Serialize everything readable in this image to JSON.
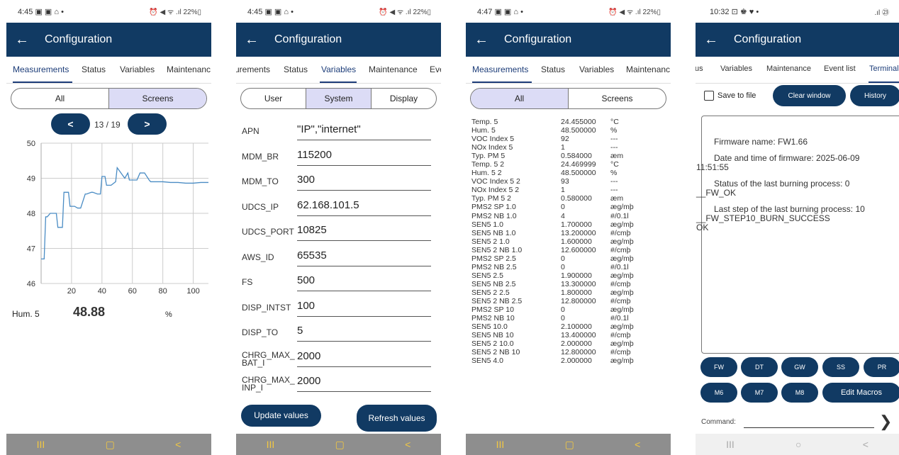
{
  "colors": {
    "appbar": "#113a63",
    "accent": "#1d3d79",
    "segment_selected": "#dcdcf6",
    "navbar": "#8e8e8e",
    "nav_icons": "#f2c842"
  },
  "screens": [
    {
      "status_time": "4:45",
      "status_icons": "▣ ▣ ⌂ •",
      "status_right": "⏰ ◀ ᯤ .ıl 22%▯",
      "title": "Configuration",
      "back_icon": "←",
      "tabs": [
        "Measurements",
        "Status",
        "Variables",
        "Maintenanc"
      ],
      "segments": [
        "All",
        "Screens"
      ],
      "pager": {
        "prev": "<",
        "label": "13 / 19",
        "next": ">"
      },
      "chart_data": {
        "type": "line",
        "ylim": [
          46,
          50
        ],
        "xlim": [
          0,
          110
        ],
        "yticks": [
          "50",
          "49",
          "48",
          "47",
          "46"
        ],
        "xticks": [
          "20",
          "40",
          "60",
          "80",
          "100"
        ],
        "x": [
          0,
          2,
          3,
          4,
          6,
          10,
          11,
          14,
          15,
          18,
          19,
          22,
          24,
          26,
          29,
          30,
          33,
          34,
          37,
          39,
          40,
          42,
          43,
          46,
          49,
          50,
          55,
          57,
          58,
          61,
          63,
          65,
          68,
          71,
          72,
          75,
          80,
          85,
          90,
          95,
          100,
          105,
          110
        ],
        "values": [
          46.7,
          46.7,
          47.9,
          47.9,
          48.0,
          48.0,
          47.6,
          47.6,
          48.6,
          48.6,
          48.2,
          48.2,
          48.15,
          48.15,
          48.55,
          48.55,
          48.6,
          48.6,
          48.55,
          48.55,
          49.05,
          49.05,
          48.8,
          48.8,
          48.9,
          49.3,
          49.0,
          49.15,
          48.95,
          48.95,
          48.95,
          49.15,
          49.15,
          48.95,
          48.9,
          48.9,
          48.9,
          48.88,
          48.88,
          48.86,
          48.86,
          48.88,
          48.88
        ]
      },
      "reading": {
        "label": "Hum. 5",
        "value": "48.88",
        "unit": "%"
      },
      "nav": [
        "III",
        "▢",
        "<"
      ]
    },
    {
      "status_time": "4:45",
      "status_icons": "▣ ▣ ⌂ •",
      "status_right": "⏰ ◀ ᯤ .ıl 22%▯",
      "title": "Configuration",
      "back_icon": "←",
      "tabs": [
        "urements",
        "Status",
        "Variables",
        "Maintenance",
        "Eve"
      ],
      "segments": [
        "User",
        "System",
        "Display"
      ],
      "fields": [
        {
          "label": "APN",
          "value": "\"IP\",\"internet\""
        },
        {
          "label": "MDM_BR",
          "value": "115200"
        },
        {
          "label": "MDM_TO",
          "value": "300"
        },
        {
          "label": "UDCS_IP",
          "value": "62.168.101.5"
        },
        {
          "label": "UDCS_PORT",
          "value": "10825"
        },
        {
          "label": "AWS_ID",
          "value": "65535"
        },
        {
          "label": "FS",
          "value": "500"
        },
        {
          "label": "DISP_INTST",
          "value": "100"
        },
        {
          "label": "DISP_TO",
          "value": "5"
        },
        {
          "label": "CHRG_MAX_ BAT_I",
          "value": "2000"
        },
        {
          "label": "CHRG_MAX_ INP_I",
          "value": "2000"
        }
      ],
      "buttons": {
        "update": "Update values",
        "refresh": "Refresh values"
      },
      "nav": [
        "III",
        "▢",
        "<"
      ]
    },
    {
      "status_time": "4:47",
      "status_icons": "▣ ▣ ⌂ •",
      "status_right": "⏰ ◀ ᯤ .ıl 22%▯",
      "title": "Configuration",
      "back_icon": "←",
      "tabs": [
        "Measurements",
        "Status",
        "Variables",
        "Maintenanc"
      ],
      "segments": [
        "All",
        "Screens"
      ],
      "rows": [
        [
          "Temp. 5",
          "24.455000",
          "°C"
        ],
        [
          "Hum. 5",
          "48.500000",
          "%"
        ],
        [
          "VOC Index 5",
          "92",
          "---"
        ],
        [
          "NOx Index 5",
          "1",
          "---"
        ],
        [
          "Typ. PM 5",
          "0.584000",
          "æm"
        ],
        [
          "Temp. 5 2",
          "24.469999",
          "°C"
        ],
        [
          "Hum. 5 2",
          "48.500000",
          "%"
        ],
        [
          "VOC Index 5 2",
          "93",
          "---"
        ],
        [
          "NOx Index 5 2",
          "1",
          "---"
        ],
        [
          "Typ. PM 5 2",
          "0.580000",
          "æm"
        ],
        [
          "PMS2 SP 1.0",
          "0",
          "æg/mþ"
        ],
        [
          "PMS2 NB 1.0",
          "4",
          "#/0.1l"
        ],
        [
          "SEN5 1.0",
          "1.700000",
          "æg/mþ"
        ],
        [
          "SEN5 NB 1.0",
          "13.200000",
          "#/cmþ"
        ],
        [
          "SEN5 2 1.0",
          "1.600000",
          "æg/mþ"
        ],
        [
          "SEN5 2 NB 1.0",
          "12.600000",
          "#/cmþ"
        ],
        [
          "PMS2 SP 2.5",
          "0",
          "æg/mþ"
        ],
        [
          "PMS2 NB 2.5",
          "0",
          "#/0.1l"
        ],
        [
          "SEN5 2.5",
          "1.900000",
          "æg/mþ"
        ],
        [
          "SEN5 NB 2.5",
          "13.300000",
          "#/cmþ"
        ],
        [
          "SEN5 2 2.5",
          "1.800000",
          "æg/mþ"
        ],
        [
          "SEN5 2 NB 2.5",
          "12.800000",
          "#/cmþ"
        ],
        [
          "PMS2 SP 10",
          "0",
          "æg/mþ"
        ],
        [
          "PMS2 NB 10",
          "0",
          "#/0.1l"
        ],
        [
          "SEN5 10.0",
          "2.100000",
          "æg/mþ"
        ],
        [
          "SEN5 NB 10",
          "13.400000",
          "#/cmþ"
        ],
        [
          "SEN5 2 10.0",
          "2.000000",
          "æg/mþ"
        ],
        [
          "SEN5 2 NB 10",
          "12.800000",
          "#/cmþ"
        ],
        [
          "SEN5 4.0",
          "2.000000",
          "æg/mþ"
        ]
      ],
      "nav": [
        "III",
        "▢",
        "<"
      ]
    },
    {
      "status_time": "10:32",
      "status_icons": "⊡ ♚ ♥ •",
      "status_right": ".ıl ㉓",
      "title": "Configuration",
      "back_icon": "←",
      "tabs": [
        "tus",
        "Variables",
        "Maintenance",
        "Event list",
        "Terminal"
      ],
      "save_label": "Save to file",
      "clear": "Clear window",
      "history": "History",
      "terminal": [
        "Firmware name: FW1.66",
        "Date and time of firmware:  2025-06-09",
        "11:51:55",
        "Status of the last burning process:  0",
        "__FW_OK",
        "Last step of the last burning process:  10",
        "__FW_STEP10_BURN_SUCCESS",
        "OK"
      ],
      "macros1": [
        "FW",
        "DT",
        "GW",
        "SS",
        "PR"
      ],
      "macros2": [
        "M6",
        "M7",
        "M8",
        "Edit Macros"
      ],
      "command_label": "Command:",
      "send_icon": "❯",
      "nav": [
        "III",
        "○",
        "<"
      ]
    }
  ]
}
